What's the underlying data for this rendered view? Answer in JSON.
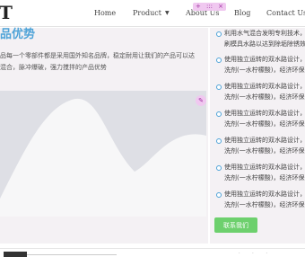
{
  "header": {
    "logo": "T",
    "nav": {
      "home": "Home",
      "product": "Product",
      "about": "About Us",
      "blog": "Blog",
      "contact": "Contact Us"
    }
  },
  "edit_toolbar": {
    "add": "+",
    "move": ":::",
    "remove": "×"
  },
  "section": {
    "title": "品优势",
    "desc_line1": "品每一个零部件都是采用国外知名品牌，稳定耐用让我们的产品可以达",
    "desc_line2": "混合，脉冲爆破，强力搅拌的产品优势"
  },
  "features": [
    {
      "line1": "利用水气混合发明专利技术，",
      "line2": "刷模具水路以达到除垢除锈效"
    },
    {
      "line1": "使用独立运转的双水路设计，",
      "line2": "洗剂(一水柠檬酸)，经济环保"
    },
    {
      "line1": "使用独立运转的双水路设计，",
      "line2": "洗剂(一水柠檬酸)，经济环保"
    },
    {
      "line1": "使用独立运转的双水路设计，",
      "line2": "洗剂(一水柠檬酸)，经济环保"
    },
    {
      "line1": "使用独立运转的双水路设计，",
      "line2": "洗剂(一水柠檬酸)，经济环保"
    },
    {
      "line1": "使用独立运转的双水路设计，",
      "line2": "洗剂(一水柠檬酸)，经济环保"
    },
    {
      "line1": "使用独立运转的双水路设计，",
      "line2": "洗剂(一水柠檬酸)，经济环保"
    }
  ],
  "contact_button": "联系我们",
  "colors": {
    "accent": "#4ea3d8",
    "button": "#6dd06d",
    "edit": "#f0c8f0"
  }
}
